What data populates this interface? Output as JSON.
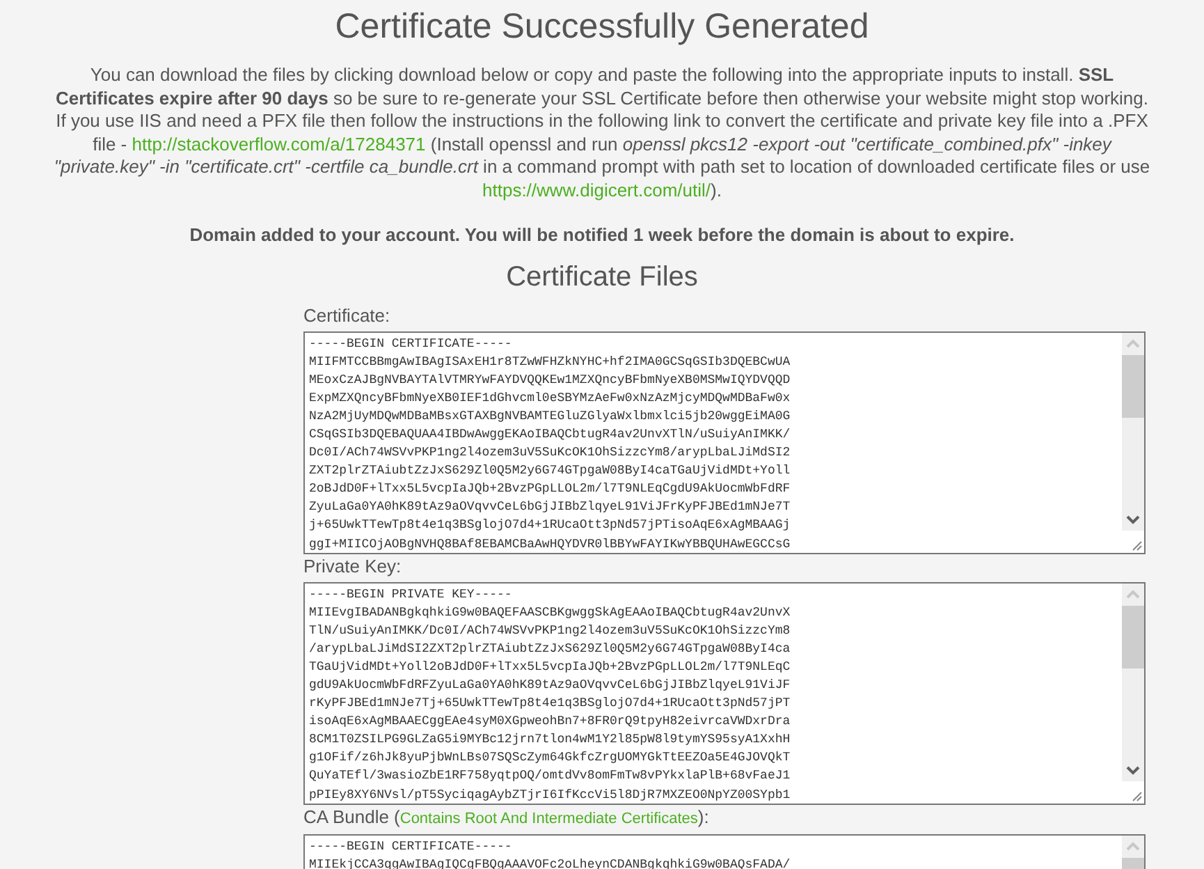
{
  "title": "Certificate Successfully Generated",
  "intro": [
    {
      "kind": "text",
      "text": "You can download the files by clicking download below or copy and paste the following into the appropriate inputs to install. "
    },
    {
      "kind": "bold",
      "text": "SSL Certificates expire after 90 days"
    },
    {
      "kind": "text",
      "text": " so be sure to re-generate your SSL Certificate before then otherwise your website might stop working. If you use IIS and need a PFX file then follow the instructions in the following link to convert the certificate and private key file into a .PFX file - "
    },
    {
      "kind": "link",
      "text": "http://stackoverflow.com/a/17284371"
    },
    {
      "kind": "text",
      "text": " (Install openssl and run "
    },
    {
      "kind": "italic",
      "text": "openssl pkcs12 -export -out \"certificate_combined.pfx\" -inkey \"private.key\" -in \"certificate.crt\" -certfile ca_bundle.crt"
    },
    {
      "kind": "text",
      "text": " in a command prompt with path set to location of downloaded certificate files or use "
    },
    {
      "kind": "link",
      "text": "https://www.digicert.com/util/"
    },
    {
      "kind": "text",
      "text": ")."
    }
  ],
  "notice": "Domain added to your account. You will be notified 1 week before the domain is about to expire.",
  "section_title": "Certificate Files",
  "fields": [
    {
      "label": [
        {
          "kind": "text",
          "text": "Certificate:"
        }
      ],
      "lines": [
        "-----BEGIN CERTIFICATE-----",
        "MIIFMTCCBBmgAwIBAgISAxEH1r8TZwWFHZkNYHC+hf2IMA0GCSqGSIb3DQEBCwUA",
        "MEoxCzAJBgNVBAYTAlVTMRYwFAYDVQQKEw1MZXQncyBFbmNyeXB0MSMwIQYDVQQD",
        "ExpMZXQncyBFbmNyeXB0IEF1dGhvcml0eSBYMzAeFw0xNzAzMjcyMDQwMDBaFw0x",
        "NzA2MjUyMDQwMDBaMBsxGTAXBgNVBAMTEGluZGlyaWxlbmxlci5jb20wggEiMA0G",
        "CSqGSIb3DQEBAQUAA4IBDwAwggEKAoIBAQCbtugR4av2UnvXTlN/uSuiyAnIMKK/",
        "Dc0I/ACh74WSVvPKP1ng2l4ozem3uV5SuKcOK1OhSizzcYm8/arypLbaLJiMdSI2",
        "ZXT2plrZTAiubtZzJxS629Zl0Q5M2y6G74GTpgaW08ByI4caTGaUjVidMDt+Yoll",
        "2oBJdD0F+lTxx5L5vcpIaJQb+2BvzPGpLLOL2m/l7T9NLEqCgdU9AkUocmWbFdRF",
        "ZyuLaGa0YA0hK89tAz9aOVqvvCeL6bGjJIBbZlqyeL91ViJFrKyPFJBEd1mNJe7T",
        "j+65UwkTTewTp8t4e1q3BSglojO7d4+1RUcaOtt3pNd57jPTisoAqE6xAgMBAAGj",
        "ggI+MIICOjAOBgNVHQ8BAf8EBAMCBaAwHQYDVR0lBBYwFAYIKwYBBQUHAwEGCCsG"
      ]
    },
    {
      "label": [
        {
          "kind": "text",
          "text": "Private Key:"
        }
      ],
      "lines": [
        "-----BEGIN PRIVATE KEY-----",
        "MIIEvgIBADANBgkqhkiG9w0BAQEFAASCBKgwggSkAgEAAoIBAQCbtugR4av2UnvX",
        "TlN/uSuiyAnIMKK/Dc0I/ACh74WSVvPKP1ng2l4ozem3uV5SuKcOK1OhSizzcYm8",
        "/arypLbaLJiMdSI2ZXT2plrZTAiubtZzJxS629Zl0Q5M2y6G74GTpgaW08ByI4ca",
        "TGaUjVidMDt+Yoll2oBJdD0F+lTxx5L5vcpIaJQb+2BvzPGpLLOL2m/l7T9NLEqC",
        "gdU9AkUocmWbFdRFZyuLaGa0YA0hK89tAz9aOVqvvCeL6bGjJIBbZlqyeL91ViJF",
        "rKyPFJBEd1mNJe7Tj+65UwkTTewTp8t4e1q3BSglojO7d4+1RUcaOtt3pNd57jPT",
        "isoAqE6xAgMBAAECggEAe4syM0XGpweohBn7+8FR0rQ9tpyH82eivrcaVWDxrDra",
        "8CM1T0ZSILPG9GLZaG5i9MYBc12jrn7tlon4wM1Y2l85pW8l9tymYS95syA1XxhH",
        "g1OFif/z6hJk8yuPjbWnLBs07SQScZym64GkfcZrgUOMYGkTtEEZOa5E4GJOVQkT",
        "QuYaTEfl/3wasioZbE1RF758yqtpOQ/omtdVv8omFmTw8vPYkxlaPlB+68vFaeJ1",
        "pPIEy8XY6NVsl/pT5SyciqagAybZTjrI6IfKccVi5l8DjR7MXZEO0NpYZ00SYpb1"
      ]
    },
    {
      "label": [
        {
          "kind": "text",
          "text": "CA Bundle ("
        },
        {
          "kind": "link",
          "text": "Contains Root And Intermediate Certificates"
        },
        {
          "kind": "text",
          "text": "):"
        }
      ],
      "lines": [
        "-----BEGIN CERTIFICATE-----",
        "MIIEkjCCA3qgAwIBAgIQCgFBQgAAAVOFc2oLheynCDANBgkqhkiG9w0BAQsFADA/"
      ]
    }
  ]
}
